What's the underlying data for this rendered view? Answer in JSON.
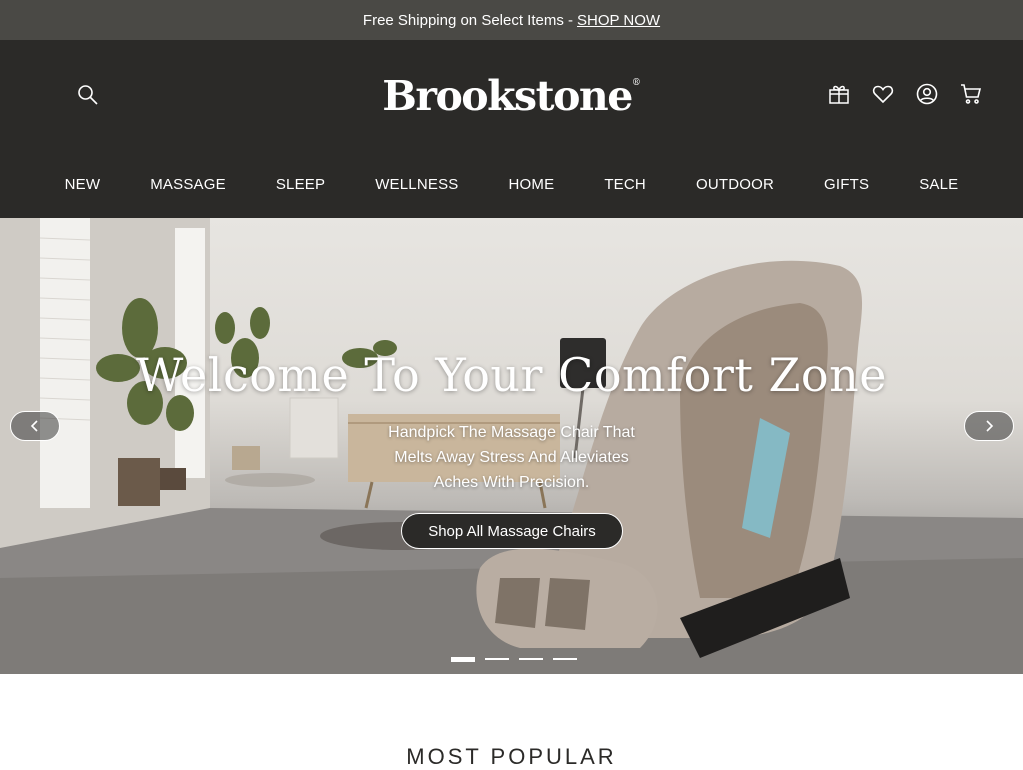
{
  "promo": {
    "text": "Free Shipping on Select Items -",
    "link": "SHOP NOW"
  },
  "header": {
    "logo": "Brookstone",
    "logo_mark": "®",
    "icons": [
      "search-icon",
      "gift-icon",
      "heart-icon",
      "account-icon",
      "cart-icon"
    ]
  },
  "nav": [
    "NEW",
    "MASSAGE",
    "SLEEP",
    "WELLNESS",
    "HOME",
    "TECH",
    "OUTDOOR",
    "GIFTS",
    "SALE"
  ],
  "hero": {
    "title": "Welcome To Your Comfort Zone",
    "subtitle_lines": [
      "Handpick The Massage Chair That",
      "Melts Away Stress And Alleviates",
      "Aches With Precision."
    ],
    "cta": "Shop All Massage Chairs",
    "slide_count": 4,
    "active_slide": 1
  },
  "section": {
    "title": "MOST POPULAR"
  },
  "colors": {
    "header_bg": "#2b2a28",
    "promo_bg": "#4a4945",
    "text": "#ffffff"
  }
}
